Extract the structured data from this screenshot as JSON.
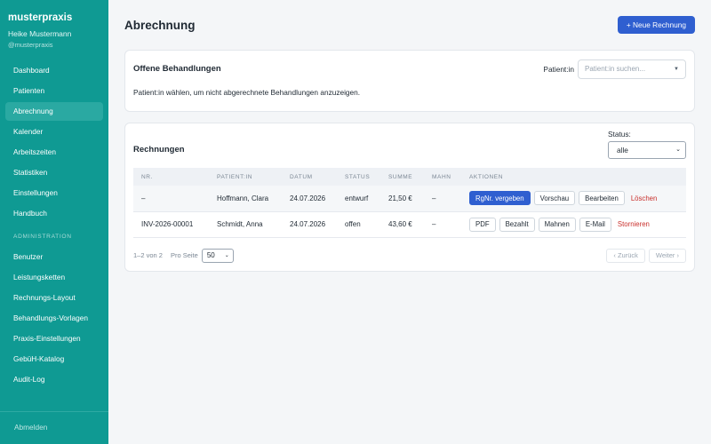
{
  "brand": {
    "name": "musterpraxis",
    "user": "Heike Mustermann",
    "handle": "@musterpraxis"
  },
  "nav": {
    "items": [
      {
        "label": "Dashboard"
      },
      {
        "label": "Patienten"
      },
      {
        "label": "Abrechnung"
      },
      {
        "label": "Kalender"
      },
      {
        "label": "Arbeitszeiten"
      },
      {
        "label": "Statistiken"
      },
      {
        "label": "Einstellungen"
      },
      {
        "label": "Handbuch"
      }
    ],
    "admin_section": "ADMINISTRATION",
    "admin_items": [
      {
        "label": "Benutzer"
      },
      {
        "label": "Leistungsketten"
      },
      {
        "label": "Rechnungs-Layout"
      },
      {
        "label": "Behandlungs-Vorlagen"
      },
      {
        "label": "Praxis-Einstellungen"
      },
      {
        "label": "GebüH-Katalog"
      },
      {
        "label": "Audit-Log"
      }
    ],
    "logout": "Abmelden"
  },
  "header": {
    "title": "Abrechnung",
    "new_invoice": "+ Neue Rechnung"
  },
  "open_treatments": {
    "title": "Offene Behandlungen",
    "patient_label": "Patient:in",
    "patient_placeholder": "Patient:in suchen...",
    "hint": "Patient:in wählen, um nicht abgerechnete Behandlungen anzuzeigen."
  },
  "invoices": {
    "title": "Rechnungen",
    "status_label": "Status:",
    "status_value": "alle",
    "columns": [
      "NR.",
      "PATIENT:IN",
      "DATUM",
      "STATUS",
      "SUMME",
      "MAHN",
      "AKTIONEN"
    ],
    "rows": [
      {
        "nr": "–",
        "patient": "Hoffmann, Clara",
        "datum": "24.07.2026",
        "status": "entwurf",
        "summe": "21,50 €",
        "mahn": "–",
        "actions": [
          "RgNr. vergeben",
          "Vorschau",
          "Bearbeiten"
        ],
        "danger": "Löschen"
      },
      {
        "nr": "INV-2026-00001",
        "patient": "Schmidt, Anna",
        "datum": "24.07.2026",
        "status": "offen",
        "summe": "43,60 €",
        "mahn": "–",
        "actions": [
          "PDF",
          "Bezahlt",
          "Mahnen",
          "E-Mail"
        ],
        "danger": "Stornieren"
      }
    ]
  },
  "pager": {
    "range": "1–2 von 2",
    "per_page_label": "Pro Seite",
    "per_page_value": "50",
    "prev": "‹ Zurück",
    "next": "Weiter ›"
  },
  "colors": {
    "sidebar": "#0f9a93",
    "primary": "#2f5fd0",
    "danger": "#c9302c"
  }
}
